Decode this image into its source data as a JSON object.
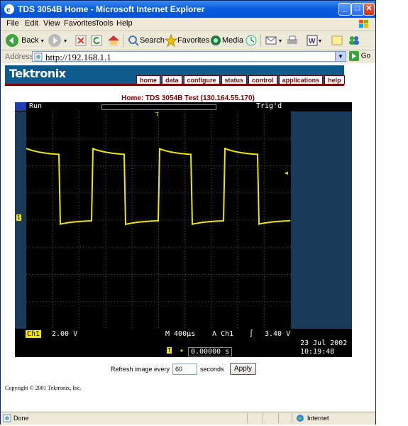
{
  "window": {
    "title": "TDS 3054B Home - Microsoft Internet Explorer",
    "min": "_",
    "max": "□",
    "close": "✕"
  },
  "menu": {
    "items": [
      "File",
      "Edit",
      "View",
      "Favorites",
      "Tools",
      "Help"
    ]
  },
  "toolbar": {
    "back": "Back",
    "search": "Search",
    "favorites": "Favorites",
    "media": "Media"
  },
  "address": {
    "label": "Address",
    "url": "http://192.168.1.1",
    "go": "Go"
  },
  "page": {
    "brand": "Tektronix",
    "nav": [
      "home",
      "data",
      "configure",
      "status",
      "control",
      "applications",
      "help"
    ],
    "title": "Home:  TDS 3054B  Test  (130.164.55.170)"
  },
  "scope": {
    "mode": "Run",
    "trigger_state": "Trig'd",
    "channel_label": "Ch1",
    "volts_div": "2.00 V",
    "timebase": "M 400µs",
    "trigger_source": "A  Ch1",
    "trigger_level": "3.40 V",
    "date": "23 Jul   2002",
    "time": "10:19:48",
    "trigger_offset": "0.00000 s",
    "ch1_marker": "1",
    "trigger_marker": "T",
    "trace_color": "#f0e600"
  },
  "refresh": {
    "label_before": "Refresh image every",
    "seconds": "60",
    "label_after": "seconds",
    "apply": "Apply"
  },
  "footer": {
    "copyright": "Copyright © 2001 Tektronix, Inc."
  },
  "status": {
    "left": "Done",
    "zone": "Internet"
  }
}
